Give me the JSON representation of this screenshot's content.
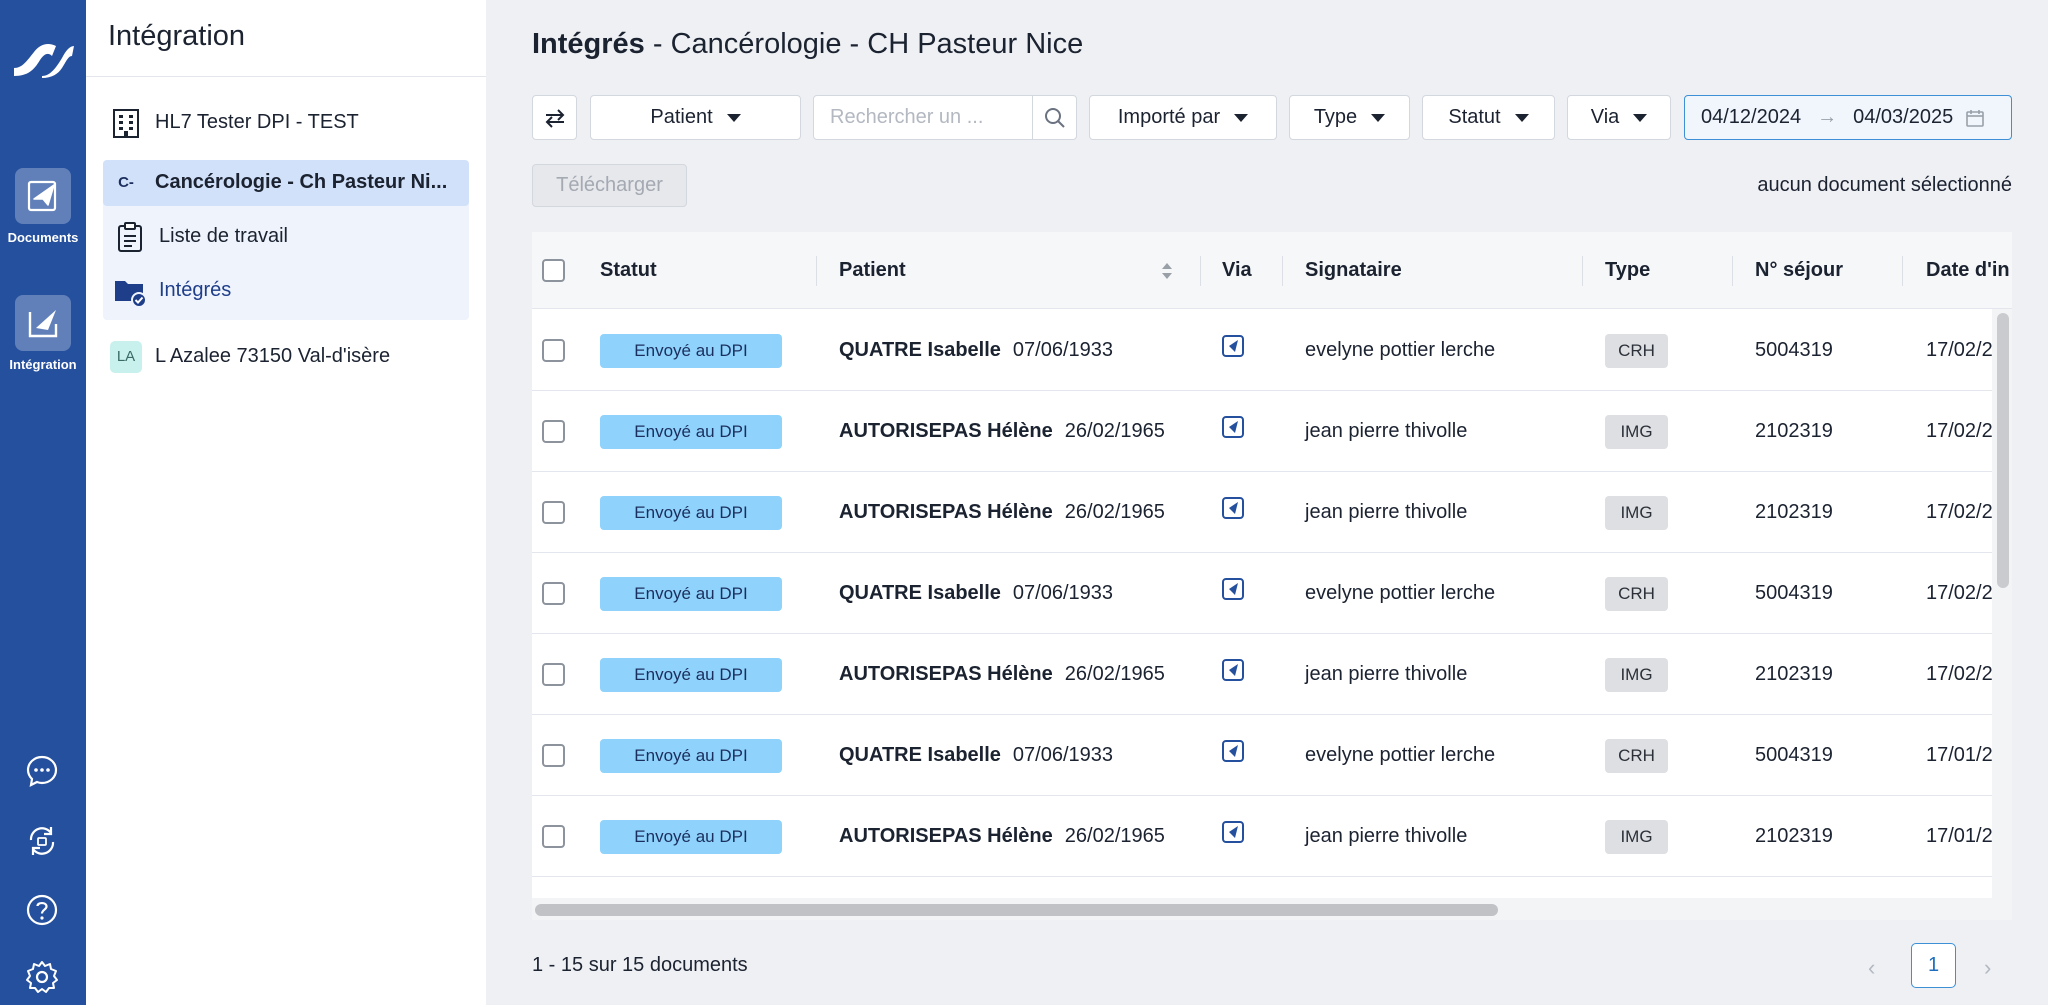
{
  "rail": {
    "items": [
      {
        "label": "Documents",
        "icon": "paper-plane-icon"
      },
      {
        "label": "Intégration",
        "icon": "integration-icon"
      }
    ],
    "bottom_icons": [
      "chat-icon",
      "sync-icon",
      "help-icon",
      "gear-icon"
    ]
  },
  "sidebar": {
    "title": "Intégration",
    "items": [
      {
        "label": "HL7 Tester DPI - TEST",
        "icon": "building-icon"
      },
      {
        "label": "Cancérologie - Ch Pasteur Ni...",
        "badge": "C-"
      },
      {
        "label": "Liste de travail",
        "icon": "clipboard-icon"
      },
      {
        "label": "Intégrés",
        "icon": "folder-check-icon"
      },
      {
        "label": "L Azalee 73150 Val-d'isère",
        "badge": "LA"
      }
    ]
  },
  "header": {
    "title_bold": "Intégrés",
    "title_rest": " - Cancérologie - CH Pasteur Nice"
  },
  "toolbar": {
    "patient_label": "Patient",
    "search_placeholder": "Rechercher un ...",
    "imported_by_label": "Importé par",
    "type_label": "Type",
    "status_label": "Statut",
    "via_label": "Via",
    "date_from": "04/12/2024",
    "date_to": "04/03/2025",
    "download_label": "Télécharger",
    "selection_info": "aucun document sélectionné"
  },
  "table": {
    "columns": [
      "Statut",
      "Patient",
      "Via",
      "Signataire",
      "Type",
      "N° séjour",
      "Date d'in"
    ],
    "rows": [
      {
        "status": "Envoyé au DPI",
        "patient_name": "QUATRE Isabelle",
        "patient_dob": "07/06/1933",
        "signer": "evelyne pottier lerche",
        "type": "CRH",
        "stay": "5004319",
        "date": "17/02/2"
      },
      {
        "status": "Envoyé au DPI",
        "patient_name": "AUTORISEPAS Hélène",
        "patient_dob": "26/02/1965",
        "signer": "jean pierre thivolle",
        "type": "IMG",
        "stay": "2102319",
        "date": "17/02/2"
      },
      {
        "status": "Envoyé au DPI",
        "patient_name": "AUTORISEPAS Hélène",
        "patient_dob": "26/02/1965",
        "signer": "jean pierre thivolle",
        "type": "IMG",
        "stay": "2102319",
        "date": "17/02/2"
      },
      {
        "status": "Envoyé au DPI",
        "patient_name": "QUATRE Isabelle",
        "patient_dob": "07/06/1933",
        "signer": "evelyne pottier lerche",
        "type": "CRH",
        "stay": "5004319",
        "date": "17/02/2"
      },
      {
        "status": "Envoyé au DPI",
        "patient_name": "AUTORISEPAS Hélène",
        "patient_dob": "26/02/1965",
        "signer": "jean pierre thivolle",
        "type": "IMG",
        "stay": "2102319",
        "date": "17/02/2"
      },
      {
        "status": "Envoyé au DPI",
        "patient_name": "QUATRE Isabelle",
        "patient_dob": "07/06/1933",
        "signer": "evelyne pottier lerche",
        "type": "CRH",
        "stay": "5004319",
        "date": "17/01/2"
      },
      {
        "status": "Envoyé au DPI",
        "patient_name": "AUTORISEPAS Hélène",
        "patient_dob": "26/02/1965",
        "signer": "jean pierre thivolle",
        "type": "IMG",
        "stay": "2102319",
        "date": "17/01/2"
      }
    ]
  },
  "footer": {
    "count": "1 - 15 sur 15 documents",
    "page": "1"
  },
  "colors": {
    "rail": "#25509e",
    "status_tag": "#8fd2fb",
    "accent": "#3d8fd6"
  }
}
